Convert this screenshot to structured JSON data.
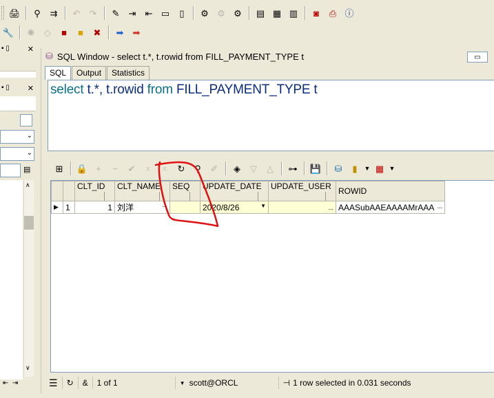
{
  "toolbar1": {
    "icons": [
      "printer",
      "binoculars-find",
      "find-next",
      "undo",
      "redo",
      "edit",
      "indent",
      "unindent",
      "uncomment",
      "comment",
      "execute",
      "break",
      "explain",
      "window-list",
      "windows",
      "tile",
      "oracle",
      "pdf",
      "info"
    ]
  },
  "toolbar2": {
    "icons": [
      "wrench",
      "paint",
      "eraser",
      "red-box",
      "yellow-box",
      "stop",
      "arrow-right-blue",
      "arrow-right-red"
    ]
  },
  "sql_window": {
    "title": "SQL Window - select t.*, t.rowid from FILL_PAYMENT_TYPE t",
    "tabs": [
      {
        "label": "SQL",
        "active": true
      },
      {
        "label": "Output",
        "active": false
      },
      {
        "label": "Statistics",
        "active": false
      }
    ],
    "query": {
      "kw_select": "select",
      "part1": " t.*, t.rowid ",
      "kw_from": "from",
      "part2": " FILL_PAYMENT_TYPE t"
    }
  },
  "grid": {
    "columns": [
      "CLT_ID",
      "CLT_NAME",
      "SEQ",
      "UPDATE_DATE",
      "UPDATE_USER",
      "ROWID"
    ],
    "rows": [
      {
        "row_no": "1",
        "CLT_ID": "1",
        "CLT_NAME": "刘洋",
        "SEQ": "",
        "UPDATE_DATE": "2020/8/26",
        "UPDATE_USER": "",
        "ROWID": "AAASubAAEAAAAMrAAA"
      }
    ],
    "row_indicator": "▶",
    "ellipsis": "..."
  },
  "statusbar": {
    "record_position": "1 of 1",
    "connection": "scott@ORCL",
    "message": "1 row selected in 0.031 seconds"
  },
  "colors": {
    "keyword": "#0b6f8a",
    "identifier": "#0a2c80",
    "annotation": "#e01010",
    "chrome": "#ece9d8"
  }
}
